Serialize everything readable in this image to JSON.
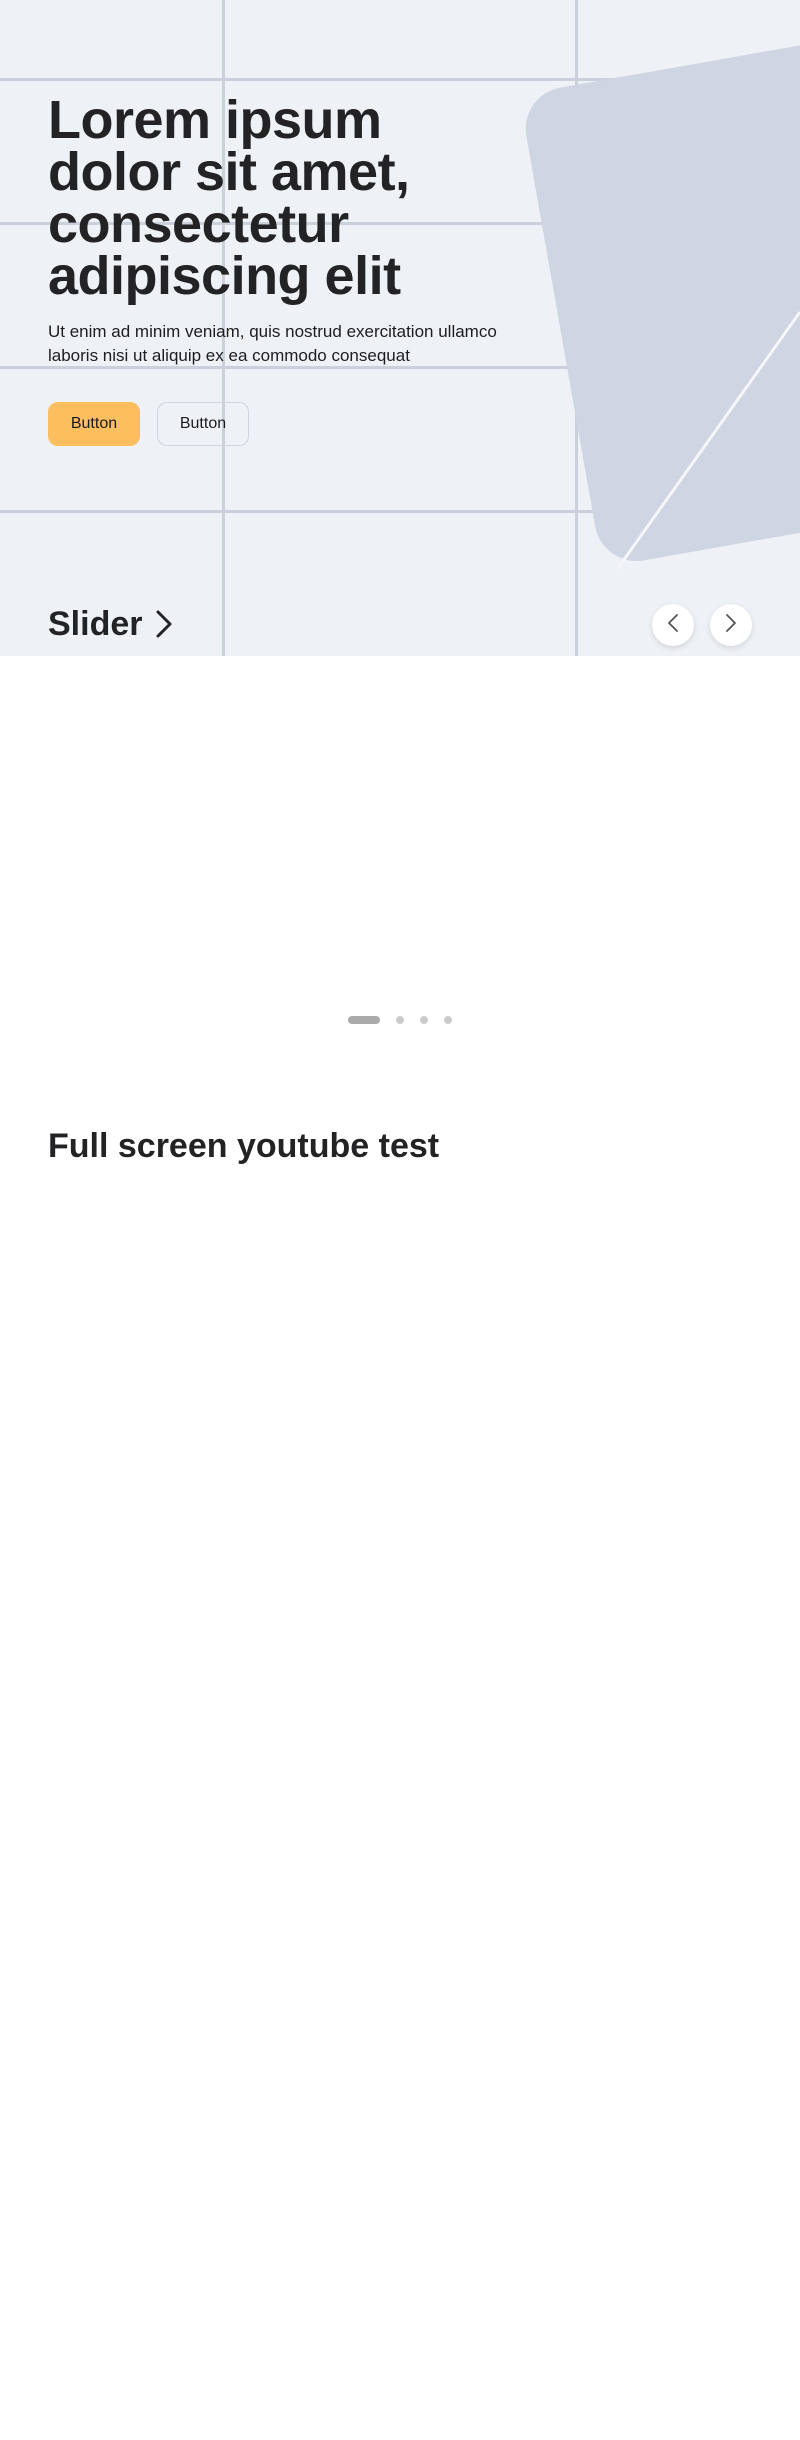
{
  "hero": {
    "title": "Lorem ipsum dolor sit amet, consectetur adipiscing elit",
    "subtitle": "Ut enim ad minim veniam, quis nostrud exercitation ullamco laboris nisi ut aliquip ex ea commodo consequat",
    "primary_button_label": "Button",
    "secondary_button_label": "Button"
  },
  "slider": {
    "heading": "Slider",
    "slide_count": 4,
    "active_slide": 1
  },
  "video_section": {
    "title": "Full screen youtube test"
  },
  "colors": {
    "hero_background": "#eef1f6",
    "grid_line": "#cbd1dc",
    "decor_card": "#cfd5e2",
    "primary_button": "#fdbf5e",
    "text_dark": "#232325",
    "dot_active": "#aaaaaa",
    "dot_inactive": "#cccccc"
  },
  "icons": {
    "slider_heading": "chevron-right-icon",
    "prev": "chevron-left-icon",
    "next": "chevron-right-icon"
  }
}
